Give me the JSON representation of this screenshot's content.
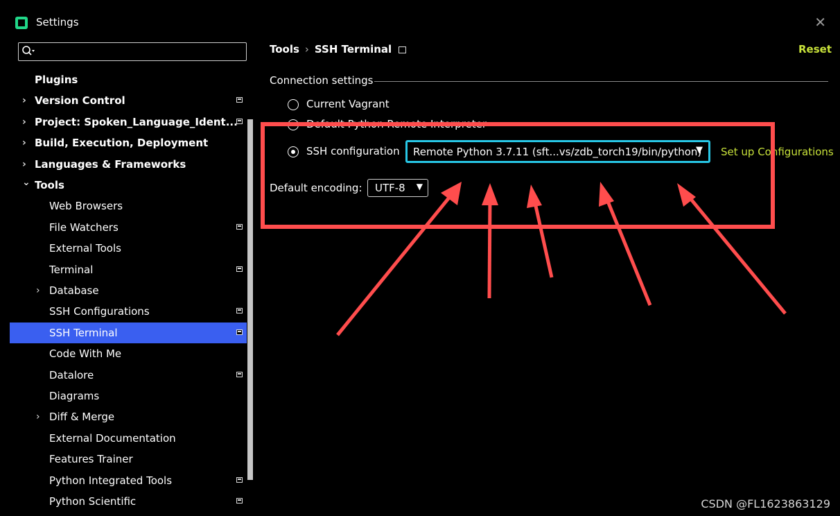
{
  "window": {
    "title": "Settings"
  },
  "search": {
    "placeholder": "",
    "value": ""
  },
  "sidebar": {
    "items": [
      {
        "label": "Plugins",
        "bold": true,
        "level": 0,
        "chevron": "",
        "proj": false
      },
      {
        "label": "Version Control",
        "bold": true,
        "level": 0,
        "chevron": ">",
        "proj": true
      },
      {
        "label": "Project: Spoken_Language_Ident...",
        "bold": true,
        "level": 0,
        "chevron": ">",
        "proj": true
      },
      {
        "label": "Build, Execution, Deployment",
        "bold": true,
        "level": 0,
        "chevron": ">",
        "proj": false
      },
      {
        "label": "Languages & Frameworks",
        "bold": true,
        "level": 0,
        "chevron": ">",
        "proj": false
      },
      {
        "label": "Tools",
        "bold": true,
        "level": 0,
        "chevron": "v",
        "proj": false
      },
      {
        "label": "Web Browsers",
        "bold": false,
        "level": 1,
        "chevron": "",
        "proj": false
      },
      {
        "label": "File Watchers",
        "bold": false,
        "level": 1,
        "chevron": "",
        "proj": true
      },
      {
        "label": "External Tools",
        "bold": false,
        "level": 1,
        "chevron": "",
        "proj": false
      },
      {
        "label": "Terminal",
        "bold": false,
        "level": 1,
        "chevron": "",
        "proj": true
      },
      {
        "label": "Database",
        "bold": false,
        "level": 1,
        "chevron": ">",
        "proj": false
      },
      {
        "label": "SSH Configurations",
        "bold": false,
        "level": 1,
        "chevron": "",
        "proj": true
      },
      {
        "label": "SSH Terminal",
        "bold": false,
        "level": 1,
        "chevron": "",
        "proj": true,
        "selected": true
      },
      {
        "label": "Code With Me",
        "bold": false,
        "level": 1,
        "chevron": "",
        "proj": false
      },
      {
        "label": "Datalore",
        "bold": false,
        "level": 1,
        "chevron": "",
        "proj": true
      },
      {
        "label": "Diagrams",
        "bold": false,
        "level": 1,
        "chevron": "",
        "proj": false
      },
      {
        "label": "Diff & Merge",
        "bold": false,
        "level": 1,
        "chevron": ">",
        "proj": false
      },
      {
        "label": "External Documentation",
        "bold": false,
        "level": 1,
        "chevron": "",
        "proj": false
      },
      {
        "label": "Features Trainer",
        "bold": false,
        "level": 1,
        "chevron": "",
        "proj": false
      },
      {
        "label": "Python Integrated Tools",
        "bold": false,
        "level": 1,
        "chevron": "",
        "proj": true
      },
      {
        "label": "Python Scientific",
        "bold": false,
        "level": 1,
        "chevron": "",
        "proj": true
      }
    ]
  },
  "breadcrumb": {
    "parent": "Tools",
    "sep": "›",
    "current": "SSH Terminal"
  },
  "reset_label": "Reset",
  "connection": {
    "section_title": "Connection settings",
    "options": [
      {
        "label": "Current Vagrant",
        "checked": false
      },
      {
        "label": "Default Python Remote Interpreter",
        "checked": false
      },
      {
        "label": "SSH configuration",
        "checked": true
      }
    ],
    "ssh_config_value": "Remote Python 3.7.11 (sft...vs/zdb_torch19/bin/python)",
    "setup_link": "Set up Configurations"
  },
  "encoding": {
    "label": "Default encoding:",
    "value": "UTF-8"
  },
  "watermark": "CSDN @FL1623863129",
  "colors": {
    "accent_link": "#c8e23a",
    "selection": "#3a5ff0",
    "annotation": "#ff4d4d",
    "focus": "#28c7e6"
  }
}
